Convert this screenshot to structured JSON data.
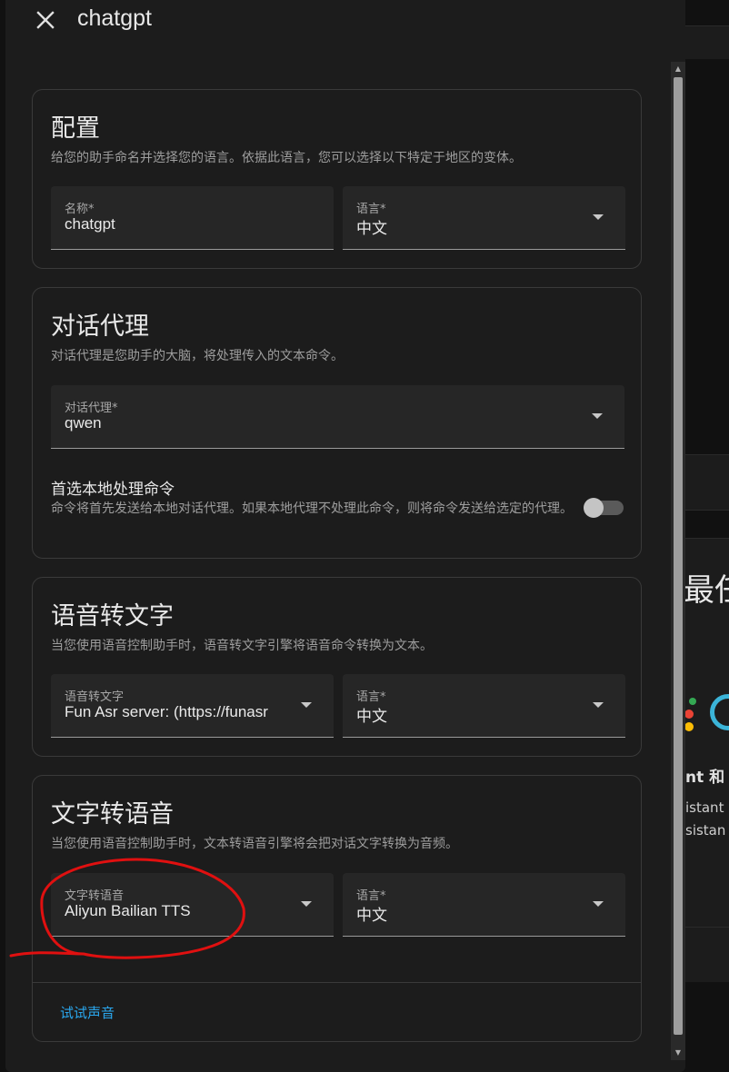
{
  "dialog": {
    "title": "chatgpt",
    "close_icon": "close-icon"
  },
  "background": {
    "heading_partial": "最任",
    "line1_partial": "nt 和",
    "line2_partial": "istant",
    "line3_partial": "sistan"
  },
  "config": {
    "title": "配置",
    "description": "给您的助手命名并选择您的语言。依据此语言，您可以选择以下特定于地区的变体。",
    "name_field": {
      "label": "名称*",
      "value": "chatgpt"
    },
    "language_field": {
      "label": "语言*",
      "value": "中文"
    }
  },
  "conversation": {
    "title": "对话代理",
    "description": "对话代理是您助手的大脑，将处理传入的文本命令。",
    "agent_field": {
      "label": "对话代理*",
      "value": "qwen"
    },
    "prefer_local": {
      "title": "首选本地处理命令",
      "description": "命令将首先发送给本地对话代理。如果本地代理不处理此命令，则将命令发送给选定的代理。",
      "enabled": false
    }
  },
  "stt": {
    "title": "语音转文字",
    "description": "当您使用语音控制助手时，语音转文字引擎将语音命令转换为文本。",
    "engine_field": {
      "label": "语音转文字",
      "value": "Fun Asr server: (https://funasr"
    },
    "language_field": {
      "label": "语言*",
      "value": "中文"
    }
  },
  "tts": {
    "title": "文字转语音",
    "description": "当您使用语音控制助手时，文本转语音引擎将会把对话文字转换为音频。",
    "engine_field": {
      "label": "文字转语音",
      "value": "Aliyun Bailian TTS"
    },
    "language_field": {
      "label": "语言*",
      "value": "中文"
    },
    "try_voice_link": "试试声音"
  },
  "colors": {
    "background": "#111111",
    "dialog": "#1c1c1c",
    "field": "#262626",
    "link": "#2aa7ee",
    "annotation": "#e01010"
  }
}
